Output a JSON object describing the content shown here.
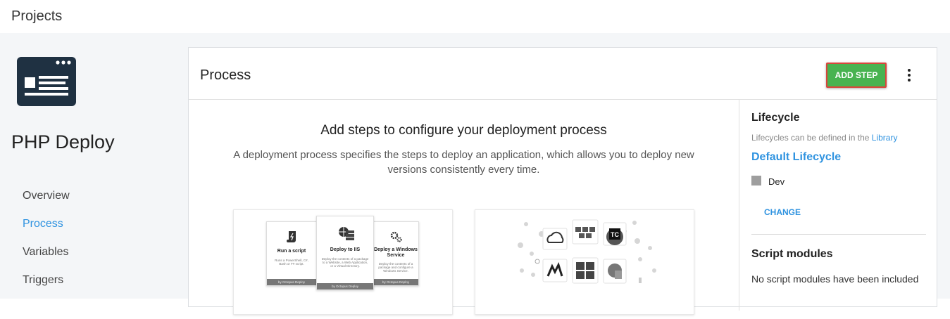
{
  "header": {
    "title": "Projects"
  },
  "project": {
    "name": "PHP Deploy",
    "nav": [
      {
        "label": "Overview",
        "active": false
      },
      {
        "label": "Process",
        "active": true
      },
      {
        "label": "Variables",
        "active": false
      },
      {
        "label": "Triggers",
        "active": false
      }
    ]
  },
  "process": {
    "title": "Process",
    "add_step_label": "ADD STEP",
    "headline": "Add steps to configure your deployment process",
    "description": "A deployment process specifies the steps to deploy an application, which allows you to deploy new versions consistently every time.",
    "templates": [
      {
        "title": "Run a script",
        "desc": "Runs a PowerShell, C#, Bash or F# script.",
        "footer": "by Octopus Deploy"
      },
      {
        "title": "Deploy to IIS",
        "desc": "Deploy the contents of a package to a Website, a Web Application, or a Virtual Directory.",
        "footer": "by Octopus Deploy"
      },
      {
        "title": "Deploy a Windows Service",
        "desc": "Deploy the contents of a package and configure a Windows Service.",
        "footer": "by Octopus Deploy"
      }
    ]
  },
  "lifecycle": {
    "heading": "Lifecycle",
    "hint_prefix": "Lifecycles can be defined in the",
    "hint_link": "Library",
    "name": "Default Lifecycle",
    "environments": [
      {
        "name": "Dev",
        "color": "#9e9e9e"
      }
    ],
    "change_label": "CHANGE"
  },
  "script_modules": {
    "heading": "Script modules",
    "empty_text": "No script modules have been included"
  },
  "colors": {
    "accent": "#2f93e0",
    "primary_button": "#48b350",
    "highlight_border": "#d9453b",
    "logo": "#1f3142"
  }
}
